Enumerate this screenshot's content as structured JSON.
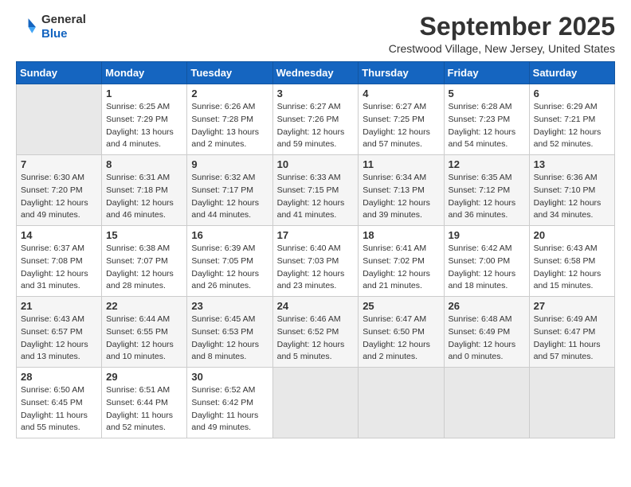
{
  "logo": {
    "general": "General",
    "blue": "Blue"
  },
  "title": "September 2025",
  "subtitle": "Crestwood Village, New Jersey, United States",
  "days_header": [
    "Sunday",
    "Monday",
    "Tuesday",
    "Wednesday",
    "Thursday",
    "Friday",
    "Saturday"
  ],
  "weeks": [
    [
      {
        "day": "",
        "info": ""
      },
      {
        "day": "1",
        "info": "Sunrise: 6:25 AM\nSunset: 7:29 PM\nDaylight: 13 hours\nand 4 minutes."
      },
      {
        "day": "2",
        "info": "Sunrise: 6:26 AM\nSunset: 7:28 PM\nDaylight: 13 hours\nand 2 minutes."
      },
      {
        "day": "3",
        "info": "Sunrise: 6:27 AM\nSunset: 7:26 PM\nDaylight: 12 hours\nand 59 minutes."
      },
      {
        "day": "4",
        "info": "Sunrise: 6:27 AM\nSunset: 7:25 PM\nDaylight: 12 hours\nand 57 minutes."
      },
      {
        "day": "5",
        "info": "Sunrise: 6:28 AM\nSunset: 7:23 PM\nDaylight: 12 hours\nand 54 minutes."
      },
      {
        "day": "6",
        "info": "Sunrise: 6:29 AM\nSunset: 7:21 PM\nDaylight: 12 hours\nand 52 minutes."
      }
    ],
    [
      {
        "day": "7",
        "info": "Sunrise: 6:30 AM\nSunset: 7:20 PM\nDaylight: 12 hours\nand 49 minutes."
      },
      {
        "day": "8",
        "info": "Sunrise: 6:31 AM\nSunset: 7:18 PM\nDaylight: 12 hours\nand 46 minutes."
      },
      {
        "day": "9",
        "info": "Sunrise: 6:32 AM\nSunset: 7:17 PM\nDaylight: 12 hours\nand 44 minutes."
      },
      {
        "day": "10",
        "info": "Sunrise: 6:33 AM\nSunset: 7:15 PM\nDaylight: 12 hours\nand 41 minutes."
      },
      {
        "day": "11",
        "info": "Sunrise: 6:34 AM\nSunset: 7:13 PM\nDaylight: 12 hours\nand 39 minutes."
      },
      {
        "day": "12",
        "info": "Sunrise: 6:35 AM\nSunset: 7:12 PM\nDaylight: 12 hours\nand 36 minutes."
      },
      {
        "day": "13",
        "info": "Sunrise: 6:36 AM\nSunset: 7:10 PM\nDaylight: 12 hours\nand 34 minutes."
      }
    ],
    [
      {
        "day": "14",
        "info": "Sunrise: 6:37 AM\nSunset: 7:08 PM\nDaylight: 12 hours\nand 31 minutes."
      },
      {
        "day": "15",
        "info": "Sunrise: 6:38 AM\nSunset: 7:07 PM\nDaylight: 12 hours\nand 28 minutes."
      },
      {
        "day": "16",
        "info": "Sunrise: 6:39 AM\nSunset: 7:05 PM\nDaylight: 12 hours\nand 26 minutes."
      },
      {
        "day": "17",
        "info": "Sunrise: 6:40 AM\nSunset: 7:03 PM\nDaylight: 12 hours\nand 23 minutes."
      },
      {
        "day": "18",
        "info": "Sunrise: 6:41 AM\nSunset: 7:02 PM\nDaylight: 12 hours\nand 21 minutes."
      },
      {
        "day": "19",
        "info": "Sunrise: 6:42 AM\nSunset: 7:00 PM\nDaylight: 12 hours\nand 18 minutes."
      },
      {
        "day": "20",
        "info": "Sunrise: 6:43 AM\nSunset: 6:58 PM\nDaylight: 12 hours\nand 15 minutes."
      }
    ],
    [
      {
        "day": "21",
        "info": "Sunrise: 6:43 AM\nSunset: 6:57 PM\nDaylight: 12 hours\nand 13 minutes."
      },
      {
        "day": "22",
        "info": "Sunrise: 6:44 AM\nSunset: 6:55 PM\nDaylight: 12 hours\nand 10 minutes."
      },
      {
        "day": "23",
        "info": "Sunrise: 6:45 AM\nSunset: 6:53 PM\nDaylight: 12 hours\nand 8 minutes."
      },
      {
        "day": "24",
        "info": "Sunrise: 6:46 AM\nSunset: 6:52 PM\nDaylight: 12 hours\nand 5 minutes."
      },
      {
        "day": "25",
        "info": "Sunrise: 6:47 AM\nSunset: 6:50 PM\nDaylight: 12 hours\nand 2 minutes."
      },
      {
        "day": "26",
        "info": "Sunrise: 6:48 AM\nSunset: 6:49 PM\nDaylight: 12 hours\nand 0 minutes."
      },
      {
        "day": "27",
        "info": "Sunrise: 6:49 AM\nSunset: 6:47 PM\nDaylight: 11 hours\nand 57 minutes."
      }
    ],
    [
      {
        "day": "28",
        "info": "Sunrise: 6:50 AM\nSunset: 6:45 PM\nDaylight: 11 hours\nand 55 minutes."
      },
      {
        "day": "29",
        "info": "Sunrise: 6:51 AM\nSunset: 6:44 PM\nDaylight: 11 hours\nand 52 minutes."
      },
      {
        "day": "30",
        "info": "Sunrise: 6:52 AM\nSunset: 6:42 PM\nDaylight: 11 hours\nand 49 minutes."
      },
      {
        "day": "",
        "info": ""
      },
      {
        "day": "",
        "info": ""
      },
      {
        "day": "",
        "info": ""
      },
      {
        "day": "",
        "info": ""
      }
    ]
  ]
}
